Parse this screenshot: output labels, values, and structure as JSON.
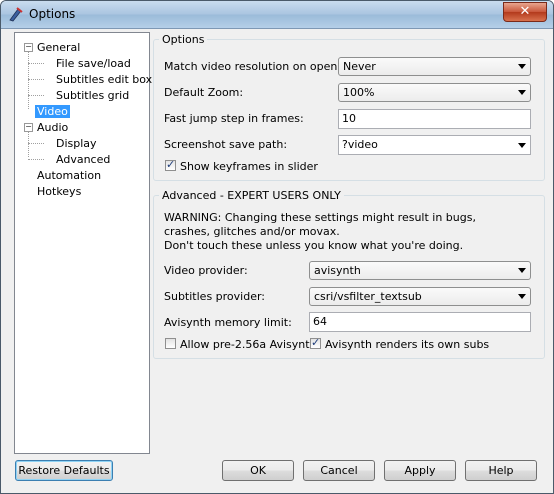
{
  "window": {
    "title": "Options",
    "close_label": "✕"
  },
  "tree": {
    "items": [
      {
        "label": "General",
        "expander": "−"
      },
      {
        "label": "File save/load"
      },
      {
        "label": "Subtitles edit box"
      },
      {
        "label": "Subtitles grid"
      },
      {
        "label": "Video"
      },
      {
        "label": "Audio",
        "expander": "−"
      },
      {
        "label": "Display"
      },
      {
        "label": "Advanced"
      },
      {
        "label": "Automation"
      },
      {
        "label": "Hotkeys"
      }
    ],
    "selected_index": 4
  },
  "options_group": {
    "title": "Options",
    "match_res_label": "Match video resolution on open:",
    "match_res_value": "Never",
    "default_zoom_label": "Default Zoom:",
    "default_zoom_value": "100%",
    "fast_jump_label": "Fast jump step in frames:",
    "fast_jump_value": "10",
    "screenshot_label": "Screenshot save path:",
    "screenshot_value": "?video",
    "keyframes_label": "Show keyframes in slider",
    "keyframes_checked": true
  },
  "advanced_group": {
    "title": "Advanced - EXPERT USERS ONLY",
    "warning_line1": "WARNING: Changing these settings might result in bugs,",
    "warning_line2": "crashes, glitches and/or movax.",
    "warning_line3": "Don't touch these unless you know what you're doing.",
    "video_provider_label": "Video provider:",
    "video_provider_value": "avisynth",
    "subs_provider_label": "Subtitles provider:",
    "subs_provider_value": "csri/vsfilter_textsub",
    "mem_limit_label": "Avisynth memory limit:",
    "mem_limit_value": "64",
    "pre256_label": "Allow pre-2.56a Avisynth",
    "pre256_checked": false,
    "own_subs_label": "Avisynth renders its own subs",
    "own_subs_checked": true
  },
  "buttons": {
    "restore": "Restore Defaults",
    "ok": "OK",
    "cancel": "Cancel",
    "apply": "Apply",
    "help": "Help"
  }
}
